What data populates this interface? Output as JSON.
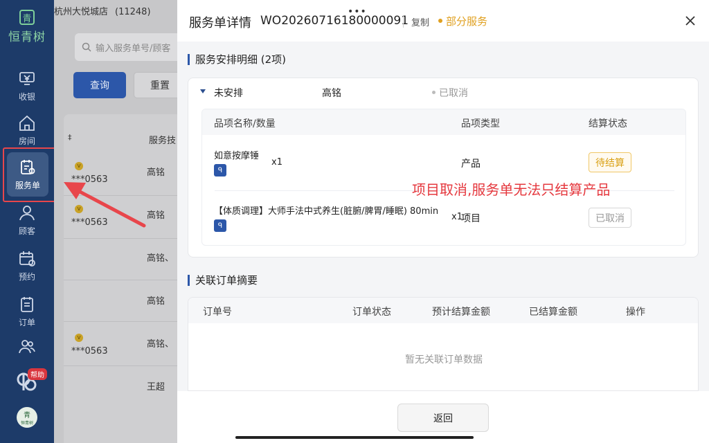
{
  "sidebar": {
    "logo_glyph": "青",
    "logo_text": "恒青树",
    "items": [
      {
        "label": "收银",
        "icon": "cashier-icon"
      },
      {
        "label": "房间",
        "icon": "home-icon"
      },
      {
        "label": "服务单",
        "icon": "service-order-icon",
        "active": true
      },
      {
        "label": "顾客",
        "icon": "user-icon"
      },
      {
        "label": "预约",
        "icon": "calendar-icon"
      },
      {
        "label": "订单",
        "icon": "order-icon"
      },
      {
        "label": "",
        "icon": "staff-icon"
      }
    ],
    "help_badge": "帮助",
    "bottom_logo": "恒青树"
  },
  "main": {
    "store_name": "杭州大悦城店",
    "store_code": "(11248)",
    "search_placeholder": "输入服务单号/顾客",
    "query_button": "查询",
    "reset_button": "重置",
    "column_header": "服务技",
    "rows": [
      {
        "phone": "***0563",
        "staff": "高铭"
      },
      {
        "phone": "***0563",
        "staff": "高铭"
      },
      {
        "phone": "",
        "staff": "高铭、"
      },
      {
        "phone": "",
        "staff": "高铭"
      },
      {
        "phone": "***0563",
        "staff": "高铭、"
      },
      {
        "phone": "",
        "staff": "王超"
      }
    ],
    "vip_label": "V",
    "row_marker": "‡"
  },
  "drawer": {
    "drag_handle": "•••",
    "title": "服务单详情",
    "order_no": "WO20260716180000091",
    "copy_label": "复制",
    "status": "部分服务",
    "status_color": "#e0a020",
    "arrangement": {
      "section_title": "服务安排明细 (2项)",
      "group_state": "未安排",
      "group_staff": "高铭",
      "group_status": "已取消",
      "headers": {
        "name": "品项名称/数量",
        "type": "品项类型",
        "settle": "结算状态"
      },
      "items": [
        {
          "name": "如意按摩锤",
          "qty": "x1",
          "type": "产品",
          "settle": "待结算"
        },
        {
          "name": "【体质调理】大师手法中式养生(脏腑/脾胃/睡眠) 80min",
          "qty": "x1",
          "type": "项目",
          "settle": "已取消"
        }
      ],
      "annotation": "项目取消,服务单无法只结算产品",
      "annotation_color": "#e5383e"
    },
    "related": {
      "section_title": "关联订单摘要",
      "headers": [
        "订单号",
        "订单状态",
        "预计结算金额",
        "已结算金额",
        "操作"
      ],
      "empty_text": "暂无关联订单数据"
    },
    "return_button": "返回"
  }
}
